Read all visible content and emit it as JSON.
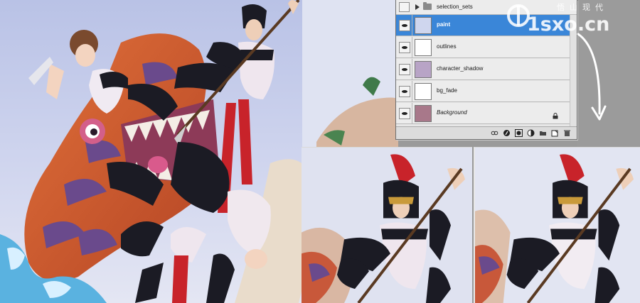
{
  "layers_panel": {
    "group": {
      "name": "selection_sets"
    },
    "layers": [
      {
        "name": "paint",
        "selected": true,
        "visible": true,
        "italic": false
      },
      {
        "name": "outlines",
        "selected": false,
        "visible": true,
        "italic": false
      },
      {
        "name": "character_shadow",
        "selected": false,
        "visible": true,
        "italic": false
      },
      {
        "name": "bg_fade",
        "selected": false,
        "visible": true,
        "italic": false
      },
      {
        "name": "Background",
        "selected": false,
        "visible": true,
        "italic": true,
        "locked": true
      }
    ],
    "toolbar_icons": [
      "link-layers-icon",
      "layer-style-icon",
      "layer-mask-icon",
      "adjustment-layer-icon",
      "new-group-icon",
      "new-layer-icon",
      "delete-layer-icon"
    ],
    "selection_color": "#3a86d8"
  },
  "watermark": {
    "brand": "1sxo.cn",
    "chinese": "悟山现代"
  },
  "colors": {
    "gray_background": "#9b9b9b",
    "sky": "#c9d4ec",
    "armor": "#1b1b24",
    "helmet_crest": "#c8232a",
    "dragon": "#d45a2e",
    "dragon_stripes": "#6a4a8c"
  }
}
